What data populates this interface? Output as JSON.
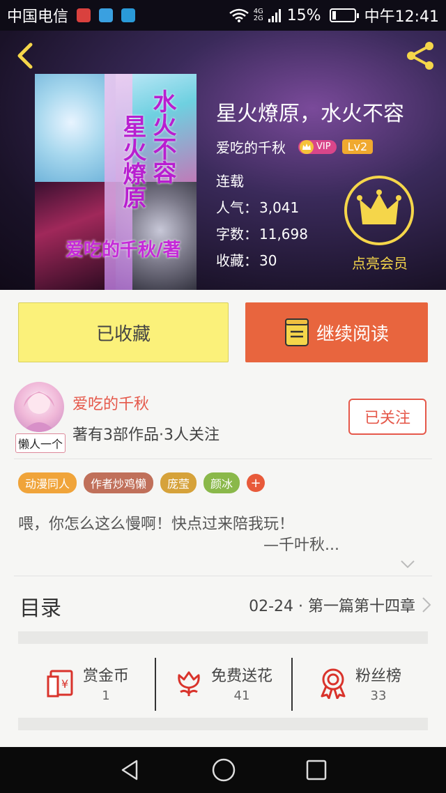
{
  "status_bar": {
    "carrier": "中国电信",
    "network": "4G\n2G",
    "battery": "15%",
    "time": "中午12:41",
    "battery_level": 0.15
  },
  "header": {
    "back_icon": "chevron-left-icon",
    "share_icon": "share-icon"
  },
  "cover": {
    "title_line1": "水火不容",
    "title_line2": "星火燎原",
    "author_text": "爱吃的千秋/著"
  },
  "book": {
    "title": "星火燎原，水火不容",
    "author": "爱吃的千秋",
    "vip_badge": "VIP",
    "level_badge": "Lv2",
    "status": "连载",
    "stats": [
      {
        "label": "人气：",
        "value": "3,041"
      },
      {
        "label": "字数：",
        "value": "11,698"
      },
      {
        "label": "收藏：",
        "value": "30"
      }
    ],
    "member_label": "点亮会员"
  },
  "actions": {
    "favorited_label": "已收藏",
    "continue_label": "继续阅读"
  },
  "author_section": {
    "avatar_tag": "懒人一个",
    "name": "爱吃的千秋",
    "meta": "著有3部作品·3人关注",
    "follow_label": "已关注"
  },
  "tags": [
    {
      "label": "动漫同人",
      "color": "#f0a43a"
    },
    {
      "label": "作者炒鸡懒",
      "color": "#c0705a"
    },
    {
      "label": "庞莹",
      "color": "#d6a23a"
    },
    {
      "label": "颜冰",
      "color": "#8ab84a"
    }
  ],
  "tag_add_label": "+",
  "intro": {
    "line1": "喂，你怎么这么慢啊！快点过来陪我玩！",
    "line2": "—千叶秋..."
  },
  "catalog": {
    "title": "目录",
    "latest": "02-24 · 第一篇第十四章"
  },
  "stats_row": [
    {
      "label": "赏金币",
      "value": "1",
      "icon": "reward-envelope-icon"
    },
    {
      "label": "免费送花",
      "value": "41",
      "icon": "flower-icon"
    },
    {
      "label": "粉丝榜",
      "value": "33",
      "icon": "ribbon-badge-icon"
    }
  ],
  "colors": {
    "accent_orange": "#e8653e",
    "fav_yellow": "#fbf17a",
    "author_red": "#e5584a",
    "gold": "#f5d64a"
  }
}
